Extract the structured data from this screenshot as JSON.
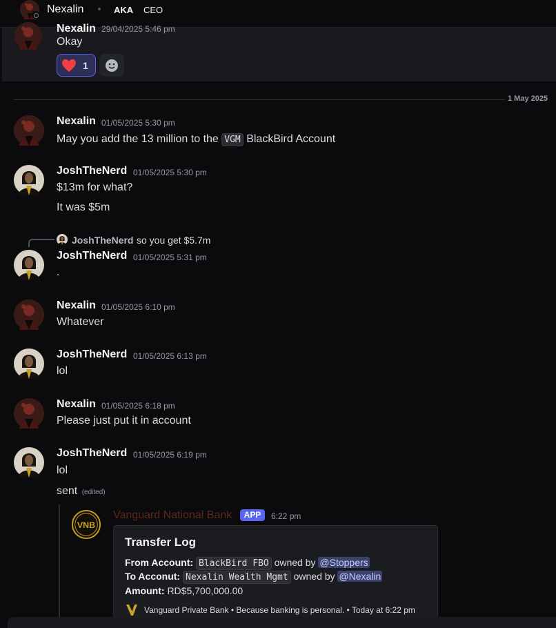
{
  "header": {
    "name": "Nexalin",
    "tag": "AKA",
    "role": "CEO"
  },
  "previous": {
    "author": "Nexalin",
    "time": "29/04/2025 5:46 pm",
    "text": "Okay",
    "reaction": {
      "emoji": "heart",
      "count": "1"
    }
  },
  "divider": {
    "label": "1 May 2025"
  },
  "messages": [
    {
      "author": "Nexalin",
      "time": "01/05/2025 5:30 pm",
      "line1_pre": "May you add the 13 million to the",
      "line1_code": "VGM",
      "line1_post": "BlackBird Account"
    },
    {
      "author": "JoshTheNerd",
      "time": "01/05/2025 5:30 pm",
      "line1": "$13m for what?",
      "line2": "It was $5m"
    },
    {
      "reply_author": "JoshTheNerd",
      "reply_text": "so you get $5.7m",
      "author": "JoshTheNerd",
      "time": "01/05/2025 5:31 pm",
      "line1": "."
    },
    {
      "author": "Nexalin",
      "time": "01/05/2025 6:10 pm",
      "line1": "Whatever"
    },
    {
      "author": "JoshTheNerd",
      "time": "01/05/2025 6:13 pm",
      "line1": "lol"
    },
    {
      "author": "Nexalin",
      "time": "01/05/2025 6:18 pm",
      "line1": "Please just put it in account"
    },
    {
      "author": "JoshTheNerd",
      "time": "01/05/2025 6:19 pm",
      "line1": "lol",
      "line2": "sent",
      "edited": "(edited)"
    }
  ],
  "bot": {
    "name": "Vanguard National Bank",
    "badge": "APP",
    "time": "6:22 pm",
    "logo_text": "VNB",
    "embed": {
      "title": "Transfer Log",
      "from_label": "From Account:",
      "from_account": "BlackBird FBO",
      "from_owned": "owned by",
      "from_mention": "@Stoppers",
      "to_label": "To Acconut:",
      "to_account": "Nexalin Wealth Mgmt",
      "to_owned": "owned by",
      "to_mention": "@Nexalin",
      "amount_label": "Amount:",
      "amount": "RD$5,700,000.00",
      "footer": "Vanguard Private Bank • Because banking is personal. • Today at 6:22 pm"
    }
  },
  "colors": {
    "accent": "#5865f2",
    "heart": "#f23f43",
    "bot_name": "#5c2a1a",
    "logo_gold": "#c9a227"
  },
  "icons": {
    "reaction": "heart-emoji-icon",
    "add_reaction": "smiley-icon",
    "footer": "vanguard-logo-icon"
  }
}
